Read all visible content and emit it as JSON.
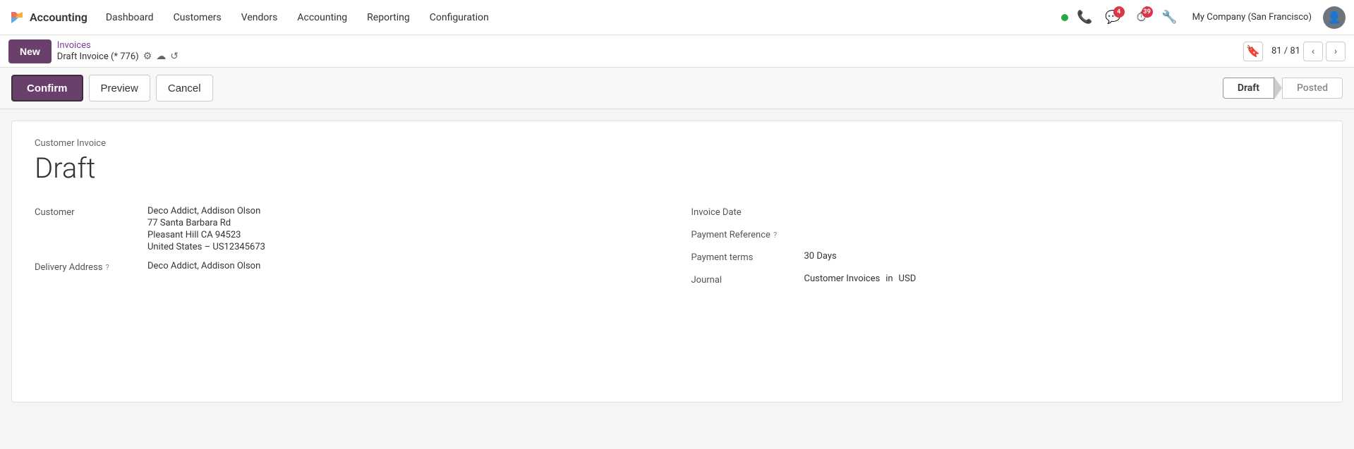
{
  "app": {
    "logo_text": "✖",
    "brand": "Accounting"
  },
  "topnav": {
    "links": [
      {
        "id": "dashboard",
        "label": "Dashboard"
      },
      {
        "id": "customers",
        "label": "Customers"
      },
      {
        "id": "vendors",
        "label": "Vendors"
      },
      {
        "id": "accounting",
        "label": "Accounting"
      },
      {
        "id": "reporting",
        "label": "Reporting"
      },
      {
        "id": "configuration",
        "label": "Configuration"
      }
    ],
    "status_dot_color": "#28a745",
    "badge_messages": "4",
    "badge_clock": "39",
    "company": "My Company (San Francisco)"
  },
  "actionbar": {
    "new_label": "New",
    "breadcrumb_link": "Invoices",
    "breadcrumb_current": "Draft Invoice (* 776)",
    "record_count": "81 / 81"
  },
  "confirmbar": {
    "confirm_label": "Confirm",
    "preview_label": "Preview",
    "cancel_label": "Cancel",
    "status_draft": "Draft",
    "status_posted": "Posted"
  },
  "invoice": {
    "type_label": "Customer Invoice",
    "status_heading": "Draft",
    "customer_label": "Customer",
    "customer_name": "Deco Addict, Addison Olson",
    "customer_address1": "77 Santa Barbara Rd",
    "customer_address2": "Pleasant Hill CA 94523",
    "customer_address3": "United States – US12345673",
    "delivery_address_label": "Delivery Address",
    "delivery_address_help": "?",
    "delivery_address_value": "Deco Addict, Addison Olson",
    "invoice_date_label": "Invoice Date",
    "invoice_date_value": "",
    "payment_reference_label": "Payment Reference",
    "payment_reference_help": "?",
    "payment_reference_value": "",
    "payment_terms_label": "Payment terms",
    "payment_terms_value": "30 Days",
    "journal_label": "Journal",
    "journal_value": "Customer Invoices",
    "journal_in": "in",
    "currency": "USD"
  }
}
